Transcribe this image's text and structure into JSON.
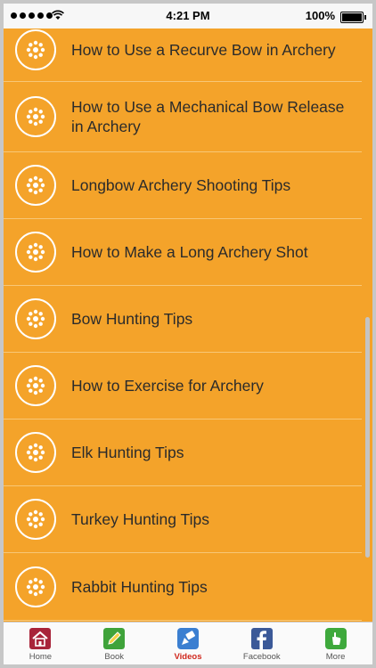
{
  "status_bar": {
    "time": "4:21 PM",
    "battery": "100%",
    "icons": [
      "signal-dots-icon",
      "wifi-icon",
      "battery-icon"
    ]
  },
  "items": [
    {
      "label": "How to Use a Recurve Bow in Archery"
    },
    {
      "label": "How to Use a Mechanical Bow Release in Archery"
    },
    {
      "label": "Longbow Archery Shooting Tips"
    },
    {
      "label": "How to Make a Long Archery Shot"
    },
    {
      "label": "Bow Hunting Tips"
    },
    {
      "label": "How to Exercise for Archery"
    },
    {
      "label": "Elk Hunting Tips"
    },
    {
      "label": "Turkey Hunting Tips"
    },
    {
      "label": "Rabbit Hunting Tips"
    }
  ],
  "tabs": [
    {
      "label": "Home",
      "icon": "home-icon"
    },
    {
      "label": "Book",
      "icon": "book-icon"
    },
    {
      "label": "Videos",
      "icon": "videos-icon",
      "active": true
    },
    {
      "label": "Facebook",
      "icon": "facebook-icon"
    },
    {
      "label": "More",
      "icon": "more-icon"
    }
  ],
  "colors": {
    "background": "#f4a32a",
    "text": "#2b2b2b",
    "active_tab": "#d0281d"
  }
}
